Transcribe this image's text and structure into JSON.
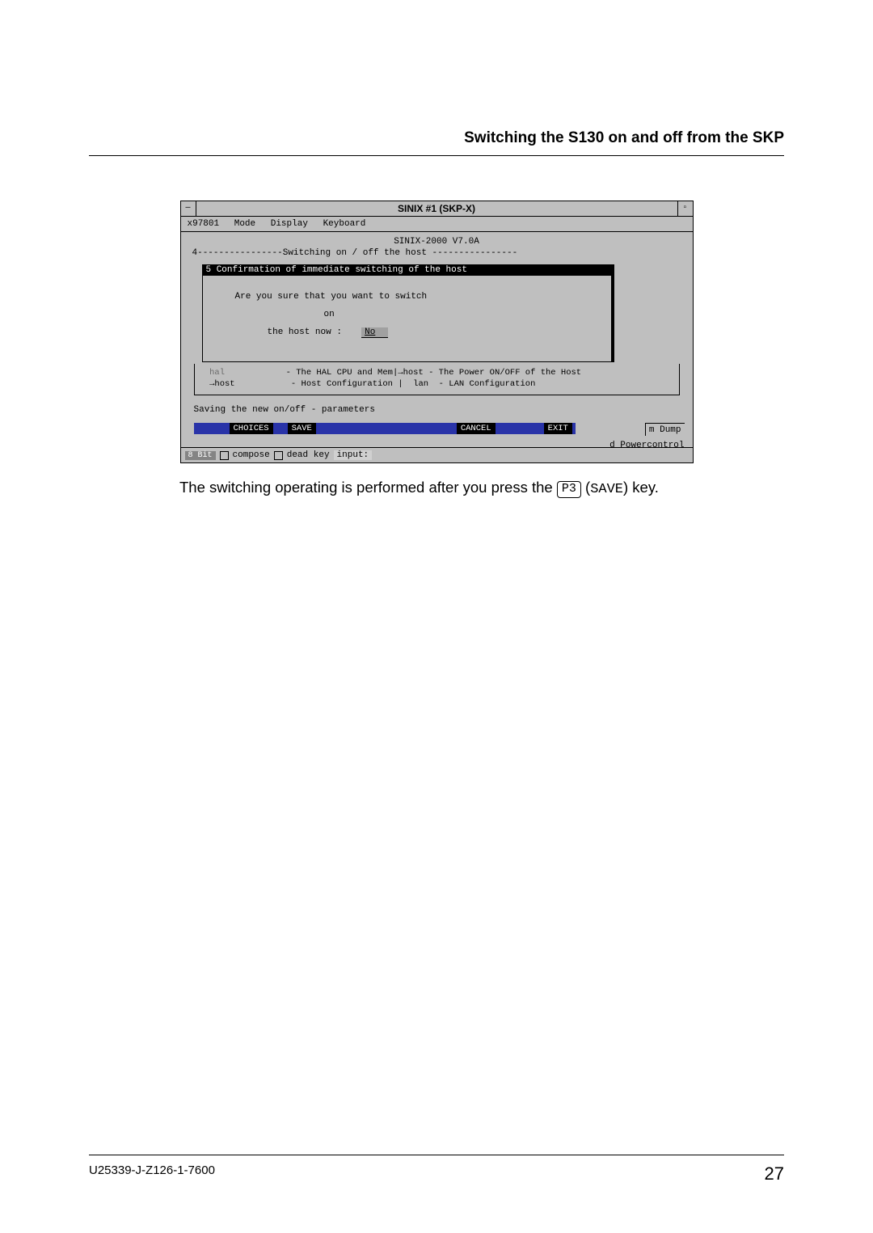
{
  "header": {
    "title": "Switching the S130 on and off from the SKP"
  },
  "window": {
    "title": "SINIX #1 (SKP-X)",
    "menubar": {
      "items": [
        "x97801",
        "Mode",
        "Display",
        "Keyboard"
      ]
    },
    "sinix_title": "SINIX-2000 V7.0A",
    "frame4_label": "4----------------Switching on / off the host ----------------",
    "box5": {
      "header": "5      Confirmation of immediate switching of the host",
      "line1": "Are you sure that you want to switch",
      "line2": "on",
      "line3_prefix": "the host now :",
      "line3_value": "No"
    },
    "side_m_dump": "m Dump",
    "d_powercontrol": "d Powercontrol",
    "halbox": {
      "line1_left_gray": "  hal",
      "line1_left_rest": "            - The HAL CPU and Mem",
      "line1_right": "→host - The Power ON/OFF of the Host",
      "line2_left": "  →host           - Host Configuration",
      "line2_right": "  lan  - LAN Configuration"
    },
    "saving": "Saving the new on/off - parameters",
    "buttons": {
      "choices": "CHOICES",
      "save": "SAVE",
      "cancel": "CANCEL",
      "exit": "EXIT"
    },
    "statusbar": {
      "tag": "8 Bit",
      "compose": "compose",
      "deadkey": "dead key",
      "input_label": "input:"
    }
  },
  "caption": {
    "before": "The switching operating is performed after you press the ",
    "keycap": "P3",
    "paren_open": " (",
    "save_mono": "SAVE",
    "after": ") key."
  },
  "footer": {
    "docid": "U25339-J-Z126-1-7600",
    "pageno": "27"
  }
}
